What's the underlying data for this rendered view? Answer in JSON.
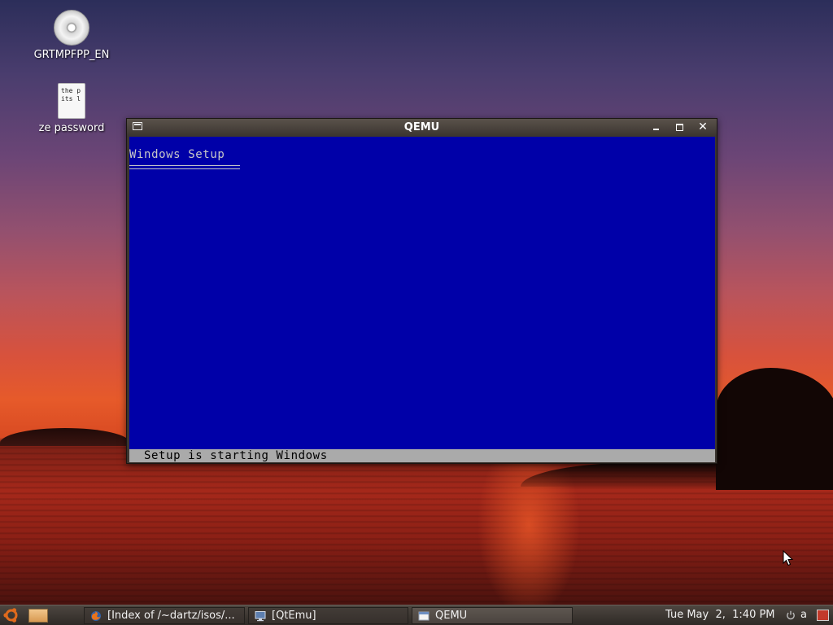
{
  "desktop": {
    "icons": [
      {
        "label": "GRTMPFPP_EN",
        "icon": "cd-disc-icon"
      },
      {
        "label": "ze password",
        "icon": "text-file-icon",
        "preview": [
          "the p",
          "its l"
        ]
      }
    ]
  },
  "qemu_window": {
    "title": "QEMU",
    "screen": {
      "heading": "Windows Setup",
      "status": "Setup is starting Windows",
      "background_color": "#0000a8",
      "status_bar_color": "#aaaaaa"
    }
  },
  "taskbar": {
    "tasks": [
      {
        "label": "[Index of /~dartz/isos/...",
        "icon": "firefox-icon",
        "active": false
      },
      {
        "label": "[QtEmu]",
        "icon": "monitor-icon",
        "active": false
      },
      {
        "label": "QEMU",
        "icon": "window-icon",
        "active": true
      }
    ],
    "clock": "Tue May  2,  1:40 PM",
    "tray_user": "a"
  }
}
